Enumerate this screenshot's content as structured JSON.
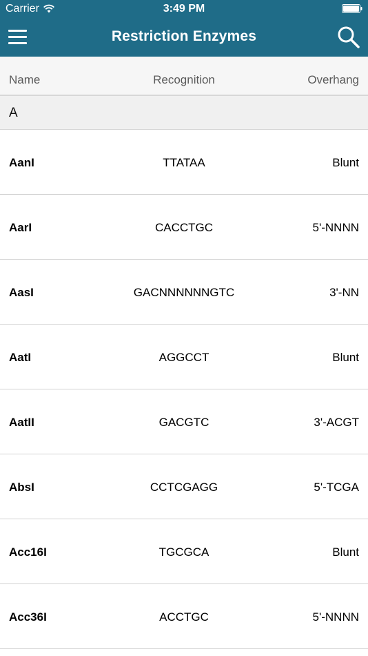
{
  "status_bar": {
    "carrier": "Carrier",
    "time": "3:49 PM"
  },
  "nav": {
    "title": "Restriction Enzymes",
    "menu_icon": "hamburger-menu-icon",
    "search_icon": "search-icon"
  },
  "columns": {
    "name": "Name",
    "recognition": "Recognition",
    "overhang": "Overhang"
  },
  "section": {
    "letter": "A"
  },
  "rows": [
    {
      "name": "AanI",
      "recognition": "TTATAA",
      "overhang": "Blunt"
    },
    {
      "name": "AarI",
      "recognition": "CACCTGC",
      "overhang": "5'-NNNN"
    },
    {
      "name": "AasI",
      "recognition": "GACNNNNNNGTC",
      "overhang": "3'-NN"
    },
    {
      "name": "AatI",
      "recognition": "AGGCCT",
      "overhang": "Blunt"
    },
    {
      "name": "AatII",
      "recognition": "GACGTC",
      "overhang": "3'-ACGT"
    },
    {
      "name": "AbsI",
      "recognition": "CCTCGAGG",
      "overhang": "5'-TCGA"
    },
    {
      "name": "Acc16I",
      "recognition": "TGCGCA",
      "overhang": "Blunt"
    },
    {
      "name": "Acc36I",
      "recognition": "ACCTGC",
      "overhang": "5'-NNNN"
    }
  ],
  "colors": {
    "nav_background": "#1f6c88",
    "header_background": "#f6f6f6",
    "section_background": "#f0f0f0"
  }
}
